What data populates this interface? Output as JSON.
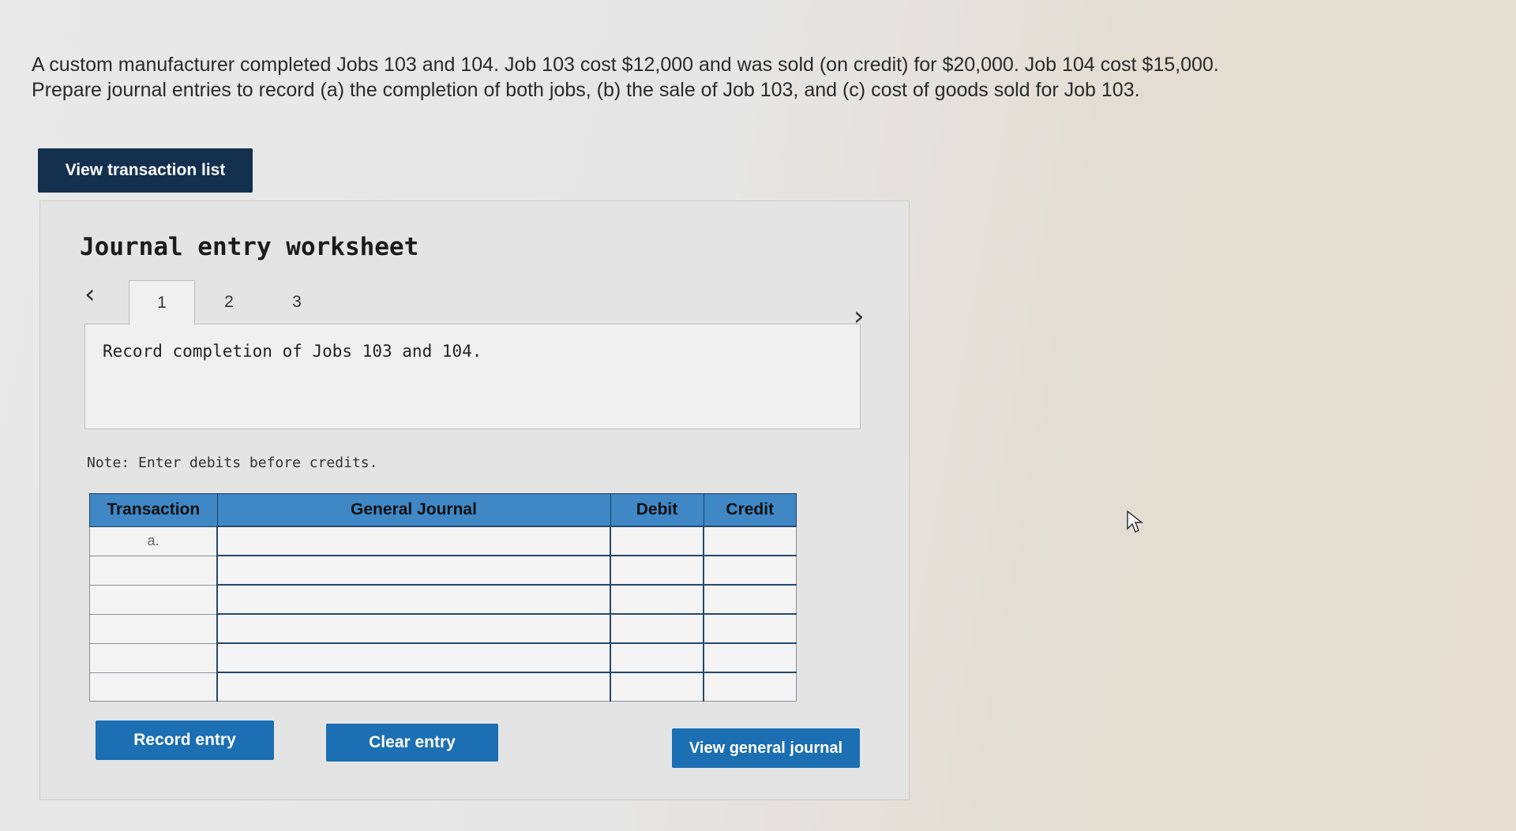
{
  "problem": {
    "line1": "A custom manufacturer completed Jobs 103 and 104. Job 103 cost $12,000 and was sold (on credit) for $20,000. Job 104 cost $15,000.",
    "line2": "Prepare journal entries to record (a) the completion of both jobs, (b) the sale of Job 103, and (c) cost of goods sold for Job 103."
  },
  "buttons": {
    "view_transactions": "View transaction list",
    "record_entry": "Record entry",
    "clear_entry": "Clear entry",
    "view_general_journal": "View general journal"
  },
  "worksheet": {
    "title": "Journal entry worksheet",
    "tabs": [
      "1",
      "2",
      "3"
    ],
    "active_tab": "1",
    "description": "Record completion of Jobs 103 and 104.",
    "note": "Note: Enter debits before credits."
  },
  "journal": {
    "headers": [
      "Transaction",
      "General Journal",
      "Debit",
      "Credit"
    ],
    "rows": [
      {
        "transaction": "a.",
        "account": "",
        "debit": "",
        "credit": ""
      },
      {
        "transaction": "",
        "account": "",
        "debit": "",
        "credit": ""
      },
      {
        "transaction": "",
        "account": "",
        "debit": "",
        "credit": ""
      },
      {
        "transaction": "",
        "account": "",
        "debit": "",
        "credit": ""
      },
      {
        "transaction": "",
        "account": "",
        "debit": "",
        "credit": ""
      },
      {
        "transaction": "",
        "account": "",
        "debit": "",
        "credit": ""
      }
    ]
  },
  "colors": {
    "header_blue": "#3f88c5",
    "button_blue": "#1b6fb2",
    "button_dark": "#13304f"
  },
  "icons": [
    "chevron-left-icon",
    "chevron-right-icon",
    "mouse-cursor-icon"
  ]
}
